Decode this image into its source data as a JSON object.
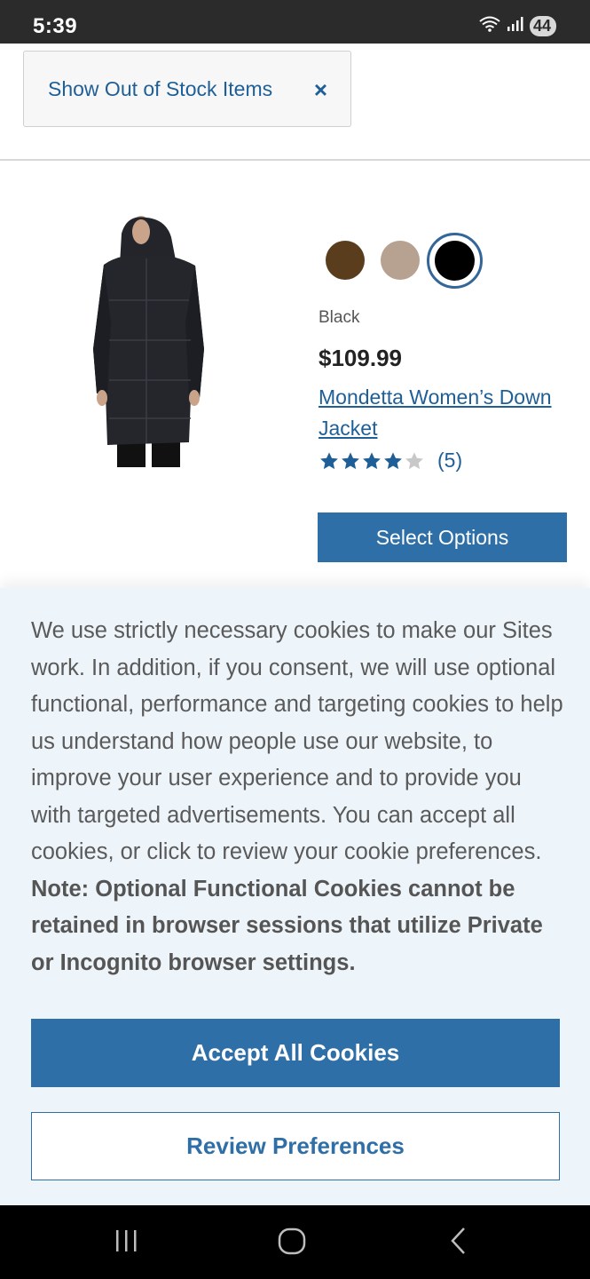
{
  "status_bar": {
    "time": "5:39",
    "battery": "44",
    "network": "6E"
  },
  "filter": {
    "label": "Show Out of Stock Items",
    "close_glyph": "×"
  },
  "product": {
    "swatches": [
      {
        "name": "brown",
        "color": "#5a3d1c",
        "selected": false
      },
      {
        "name": "beige",
        "color": "#b7a190",
        "selected": false
      },
      {
        "name": "black",
        "color": "#000000",
        "selected": true
      }
    ],
    "color_name": "Black",
    "price": "$109.99",
    "title": "Mondetta Women’s Down Jacket",
    "rating": 4,
    "rating_max": 5,
    "review_count": "(5)",
    "select_options_label": "Select Options"
  },
  "cookie_banner": {
    "text": "We use strictly necessary cookies to make our Sites work. In addition, if you consent, we will use optional functional, performance and targeting cookies to help us understand how people use our website, to improve your user experience and to provide you with targeted advertisements. You can accept all cookies, or click to review your cookie preferences.",
    "note": "Note: Optional Functional Cookies cannot be retained in browser sessions that utilize Private or Incognito browser settings.",
    "accept_label": "Accept All Cookies",
    "review_label": "Review Preferences"
  },
  "colors": {
    "accent": "#2f6fa8",
    "link": "#1f5f97",
    "banner_bg": "#eef5fa"
  },
  "nav": {
    "icons": [
      "recent-apps-icon",
      "home-icon",
      "back-icon"
    ]
  }
}
